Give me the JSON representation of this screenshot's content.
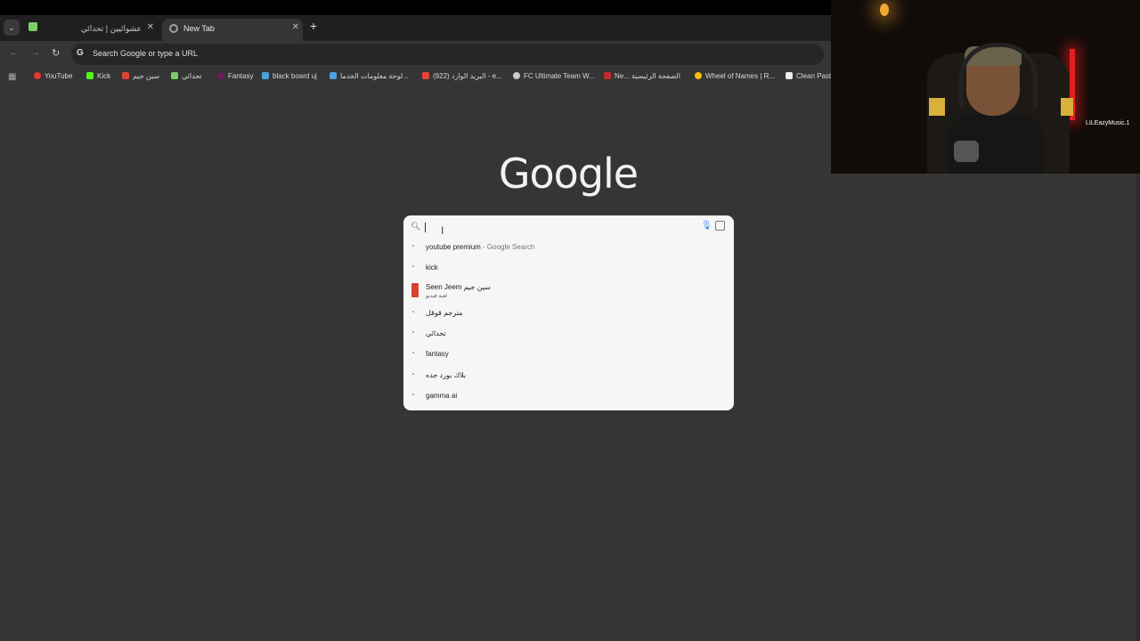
{
  "tabs": [
    {
      "label": "عشوائيين | تحدائي"
    },
    {
      "label": "New Tab"
    }
  ],
  "toolbar": {
    "omnibox_text": "Search Google or type a URL"
  },
  "bookmarks": [
    {
      "label": "YouTube",
      "color": "#e53935"
    },
    {
      "label": "Kick",
      "color": "#53fc18"
    },
    {
      "label": "سين جيم",
      "color": "#d9432f"
    },
    {
      "label": "تحدائي",
      "color": "#7bcf6b"
    },
    {
      "label": "Fantasy",
      "color": "#6a1b5a"
    },
    {
      "label": "black board uj",
      "color": "#4aa3df"
    },
    {
      "label": "لوحة معلومات الخدما...",
      "color": "#4aa3df"
    },
    {
      "label": "(922) البريد الوارد - e...",
      "color": "#ea4335"
    },
    {
      "label": "FC Ultimate Team W...",
      "color": "#cccccc"
    },
    {
      "label": "Ne... الصفحة الرئيسية",
      "color": "#c62828"
    },
    {
      "label": "Wheel of Names | R...",
      "color": "#fbbc05"
    },
    {
      "label": "Clean Past",
      "color": "#eeeeee"
    }
  ],
  "logo": "Google",
  "search": {
    "value": "",
    "suggestions": [
      {
        "text": "youtube premium",
        "sub": " - Google Search"
      },
      {
        "text": "kick"
      },
      {
        "text": "Seen Jeem سين جيم",
        "sub2": "لعبة فيديو"
      },
      {
        "text": "مترجم قوقل"
      },
      {
        "text": "تحدائي"
      },
      {
        "text": "fantasy"
      },
      {
        "text": "بلاك بورد جده"
      },
      {
        "text": "gamma ai"
      }
    ]
  },
  "webcam": {
    "handle": "LILEazyMusic.1"
  }
}
